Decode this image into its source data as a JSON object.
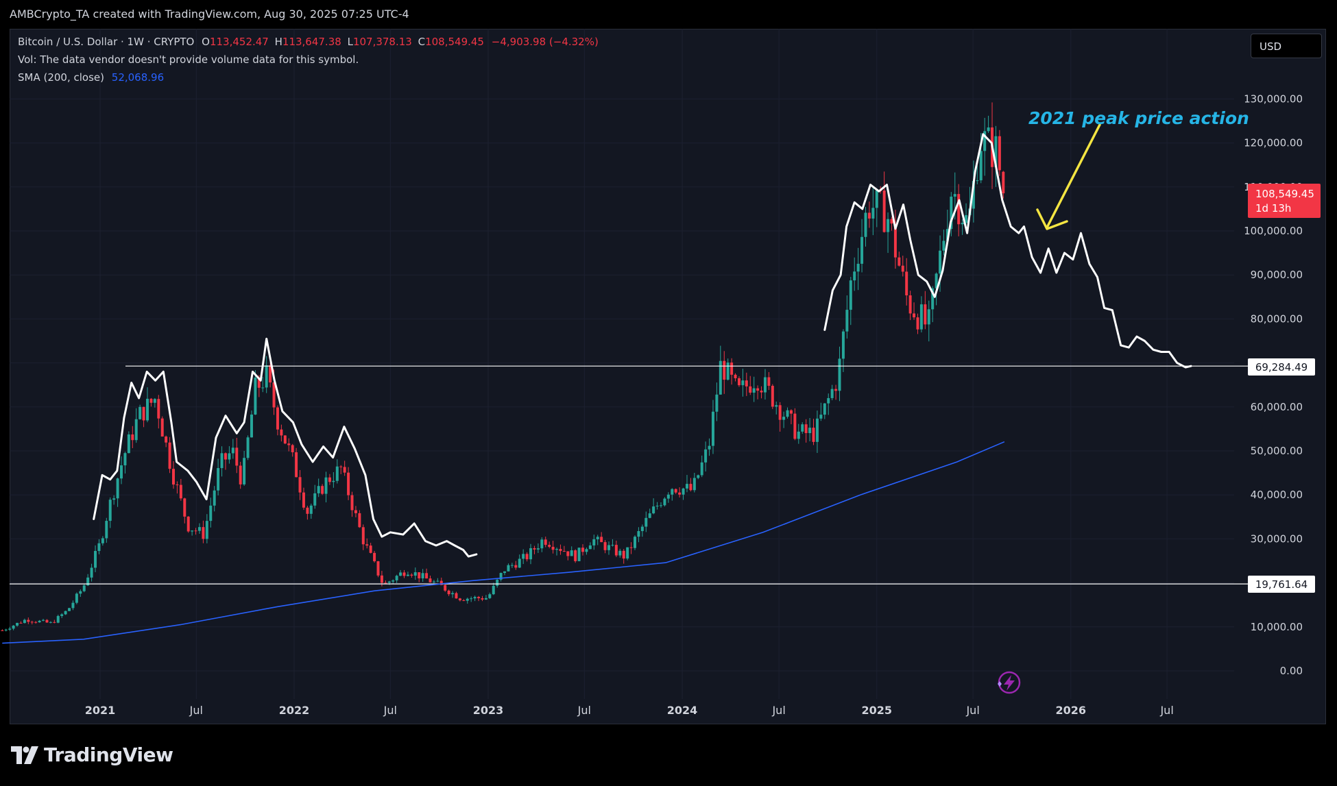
{
  "header": {
    "attribution": "AMBCrypto_TA created with TradingView.com, Aug 30, 2025 07:25 UTC-4"
  },
  "legend": {
    "symbol": "Bitcoin / U.S. Dollar · 1W · CRYPTO",
    "o_label": "O",
    "o_value": "113,452.47",
    "h_label": "H",
    "h_value": "113,647.38",
    "l_label": "L",
    "l_value": "107,378.13",
    "c_label": "C",
    "c_value": "108,549.45",
    "change": "−4,903.98 (−4.32%)",
    "vol": "Vol: The data vendor doesn't provide volume data for this symbol.",
    "sma_label": "SMA (200, close)",
    "sma_value": "52,068.96"
  },
  "currency_button": "USD",
  "price_tag": {
    "price": "108,549.45",
    "countdown": "1d 13h"
  },
  "level_labels": {
    "upper": "69,284.49",
    "lower": "19,761.64"
  },
  "annotation": "2021 peak price action",
  "brand": "TradingView",
  "colors": {
    "up": "#26a69a",
    "down": "#f23645",
    "sma": "#2962ff",
    "overlay": "#ffffff",
    "arrow": "#f4e542",
    "annotation": "#26b5e6",
    "background": "#131722"
  },
  "chart_data": {
    "type": "candlestick",
    "title": "Bitcoin / U.S. Dollar · 1W · CRYPTO",
    "xlabel": "",
    "ylabel": "",
    "ylim": [
      0,
      130000
    ],
    "y_ticks": [
      "130,000.00",
      "120,000.00",
      "110,000.00",
      "100,000.00",
      "90,000.00",
      "80,000.00",
      "70,000.00",
      "60,000.00",
      "50,000.00",
      "40,000.00",
      "30,000.00",
      "20,000.00",
      "10,000.00",
      "0.00"
    ],
    "x_ticks": [
      {
        "label": "2021",
        "date": "2021-01-01",
        "bold": true
      },
      {
        "label": "Jul",
        "date": "2021-07-01",
        "bold": false
      },
      {
        "label": "2022",
        "date": "2022-01-01",
        "bold": true
      },
      {
        "label": "Jul",
        "date": "2022-07-01",
        "bold": false
      },
      {
        "label": "2023",
        "date": "2023-01-01",
        "bold": true
      },
      {
        "label": "Jul",
        "date": "2023-07-01",
        "bold": false
      },
      {
        "label": "2024",
        "date": "2024-01-01",
        "bold": true
      },
      {
        "label": "Jul",
        "date": "2024-07-01",
        "bold": false
      },
      {
        "label": "2025",
        "date": "2025-01-01",
        "bold": true
      },
      {
        "label": "Jul",
        "date": "2025-07-01",
        "bold": false
      },
      {
        "label": "2026",
        "date": "2026-01-01",
        "bold": true
      },
      {
        "label": "Jul",
        "date": "2026-07-01",
        "bold": false
      }
    ],
    "horizontal_levels": [
      69284.49,
      19761.64
    ],
    "price_series": {
      "name": "BTCUSD weekly close (approx.)",
      "points": [
        [
          "2020-07-01",
          9200
        ],
        [
          "2020-08-15",
          11700
        ],
        [
          "2020-10-01",
          10800
        ],
        [
          "2020-11-01",
          13800
        ],
        [
          "2020-12-01",
          19200
        ],
        [
          "2021-01-01",
          29000
        ],
        [
          "2021-01-15",
          36000
        ],
        [
          "2021-02-15",
          49000
        ],
        [
          "2021-03-15",
          58000
        ],
        [
          "2021-04-15",
          62000
        ],
        [
          "2021-05-15",
          46000
        ],
        [
          "2021-06-15",
          33000
        ],
        [
          "2021-07-15",
          31000
        ],
        [
          "2021-08-15",
          47000
        ],
        [
          "2021-09-07",
          50000
        ],
        [
          "2021-09-25",
          43000
        ],
        [
          "2021-10-20",
          64000
        ],
        [
          "2021-11-10",
          67000
        ],
        [
          "2021-12-01",
          57000
        ],
        [
          "2022-01-01",
          47000
        ],
        [
          "2022-01-25",
          36000
        ],
        [
          "2022-03-01",
          43000
        ],
        [
          "2022-03-30",
          46000
        ],
        [
          "2022-05-10",
          30000
        ],
        [
          "2022-06-18",
          19500
        ],
        [
          "2022-08-01",
          23000
        ],
        [
          "2022-10-01",
          19500
        ],
        [
          "2022-11-10",
          16500
        ],
        [
          "2022-12-31",
          16600
        ],
        [
          "2023-01-31",
          23000
        ],
        [
          "2023-03-15",
          26000
        ],
        [
          "2023-04-15",
          30000
        ],
        [
          "2023-06-15",
          26000
        ],
        [
          "2023-07-15",
          30000
        ],
        [
          "2023-09-15",
          26000
        ],
        [
          "2023-10-25",
          34000
        ],
        [
          "2023-12-10",
          42000
        ],
        [
          "2024-01-20",
          41000
        ],
        [
          "2024-02-20",
          51000
        ],
        [
          "2024-03-14",
          70000
        ],
        [
          "2024-04-15",
          63000
        ],
        [
          "2024-05-20",
          67000
        ],
        [
          "2024-06-20",
          62000
        ],
        [
          "2024-08-05",
          54000
        ],
        [
          "2024-09-07",
          54000
        ],
        [
          "2024-10-20",
          67000
        ],
        [
          "2024-11-15",
          90000
        ],
        [
          "2024-12-17",
          106000
        ],
        [
          "2025-01-20",
          104000
        ],
        [
          "2025-02-28",
          84000
        ],
        [
          "2025-04-08",
          78000
        ],
        [
          "2025-05-22",
          110000
        ],
        [
          "2025-06-22",
          101000
        ],
        [
          "2025-07-14",
          121000
        ],
        [
          "2025-08-14",
          118000
        ],
        [
          "2025-08-29",
          108549
        ]
      ]
    },
    "sma_series": {
      "name": "SMA (200, close)",
      "points": [
        [
          "2020-07-01",
          6300
        ],
        [
          "2020-12-01",
          7200
        ],
        [
          "2021-06-01",
          10500
        ],
        [
          "2021-12-01",
          14600
        ],
        [
          "2022-06-01",
          18200
        ],
        [
          "2022-12-01",
          20500
        ],
        [
          "2023-06-01",
          22400
        ],
        [
          "2023-12-01",
          24600
        ],
        [
          "2024-06-01",
          31500
        ],
        [
          "2024-12-01",
          40000
        ],
        [
          "2025-06-01",
          47500
        ],
        [
          "2025-08-29",
          52068.96
        ]
      ]
    },
    "overlay_series": {
      "name": "",
      "points": [
        [
          "2020-12-20",
          34500
        ],
        [
          "2021-01-05",
          44500
        ],
        [
          "2021-01-20",
          43500
        ],
        [
          "2021-02-02",
          45500
        ],
        [
          "2021-02-15",
          57500
        ],
        [
          "2021-03-01",
          65500
        ],
        [
          "2021-03-15",
          62000
        ],
        [
          "2021-03-30",
          68000
        ],
        [
          "2021-04-15",
          66000
        ],
        [
          "2021-04-30",
          68000
        ],
        [
          "2021-05-15",
          56500
        ],
        [
          "2021-05-25",
          47500
        ],
        [
          "2021-06-15",
          45500
        ],
        [
          "2021-07-01",
          43000
        ],
        [
          "2021-07-20",
          39000
        ],
        [
          "2021-08-07",
          53000
        ],
        [
          "2021-08-25",
          58000
        ],
        [
          "2021-09-15",
          54000
        ],
        [
          "2021-09-29",
          56500
        ],
        [
          "2021-10-15",
          68000
        ],
        [
          "2021-10-30",
          66000
        ],
        [
          "2021-11-10",
          75500
        ],
        [
          "2021-11-25",
          66000
        ],
        [
          "2021-12-10",
          59000
        ],
        [
          "2021-12-30",
          56500
        ],
        [
          "2022-01-15",
          51500
        ],
        [
          "2022-02-05",
          47500
        ],
        [
          "2022-02-25",
          51000
        ],
        [
          "2022-03-15",
          48500
        ],
        [
          "2022-04-05",
          55500
        ],
        [
          "2022-04-25",
          50500
        ],
        [
          "2022-05-15",
          44500
        ],
        [
          "2022-05-30",
          34500
        ],
        [
          "2022-06-15",
          30500
        ],
        [
          "2022-07-01",
          31500
        ],
        [
          "2022-07-25",
          31000
        ],
        [
          "2022-08-15",
          33500
        ],
        [
          "2022-09-05",
          29500
        ],
        [
          "2022-09-25",
          28500
        ],
        [
          "2022-10-15",
          29500
        ],
        [
          "2022-10-30",
          28500
        ],
        [
          "2022-11-15",
          27500
        ],
        [
          "2022-11-25",
          26000
        ],
        [
          "2022-12-10",
          26500
        ]
      ]
    },
    "overlay_series_2": {
      "name": "",
      "points": [
        [
          "2024-09-25",
          77500
        ],
        [
          "2024-10-10",
          86500
        ],
        [
          "2024-10-25",
          90000
        ],
        [
          "2024-11-05",
          101000
        ],
        [
          "2024-11-20",
          106500
        ],
        [
          "2024-12-05",
          105000
        ],
        [
          "2024-12-20",
          110500
        ],
        [
          "2025-01-05",
          109000
        ],
        [
          "2025-01-20",
          110500
        ],
        [
          "2025-02-05",
          100500
        ],
        [
          "2025-02-20",
          106000
        ],
        [
          "2025-03-05",
          98000
        ],
        [
          "2025-03-20",
          90000
        ],
        [
          "2025-04-05",
          88500
        ],
        [
          "2025-04-20",
          85000
        ],
        [
          "2025-05-05",
          91000
        ],
        [
          "2025-05-20",
          102000
        ],
        [
          "2025-06-05",
          107000
        ],
        [
          "2025-06-20",
          99500
        ],
        [
          "2025-07-05",
          113500
        ],
        [
          "2025-07-20",
          122000
        ],
        [
          "2025-08-05",
          120000
        ],
        [
          "2025-08-25",
          107000
        ],
        [
          "2025-09-10",
          101000
        ],
        [
          "2025-09-25",
          99500
        ],
        [
          "2025-10-05",
          101000
        ],
        [
          "2025-10-20",
          94000
        ],
        [
          "2025-11-05",
          90500
        ],
        [
          "2025-11-20",
          96000
        ],
        [
          "2025-12-05",
          90500
        ],
        [
          "2025-12-20",
          95000
        ],
        [
          "2026-01-05",
          93500
        ],
        [
          "2026-01-20",
          99500
        ],
        [
          "2026-02-05",
          92500
        ],
        [
          "2026-02-20",
          89500
        ],
        [
          "2026-03-05",
          82500
        ],
        [
          "2026-03-20",
          82000
        ],
        [
          "2026-04-05",
          74000
        ],
        [
          "2026-04-20",
          73500
        ],
        [
          "2026-05-05",
          76000
        ],
        [
          "2026-05-20",
          75000
        ],
        [
          "2026-06-05",
          73000
        ],
        [
          "2026-06-20",
          72500
        ],
        [
          "2026-07-05",
          72500
        ],
        [
          "2026-07-20",
          70000
        ],
        [
          "2026-08-05",
          69000
        ],
        [
          "2026-08-15",
          69284
        ]
      ]
    }
  }
}
